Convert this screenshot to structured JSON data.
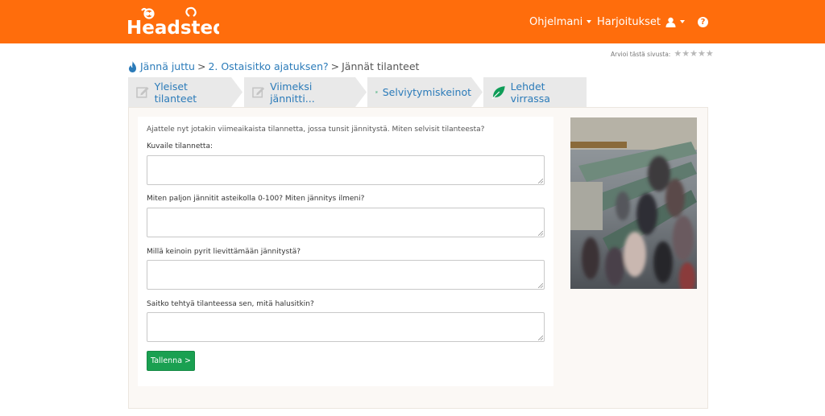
{
  "header": {
    "logo_text": "Headsted",
    "nav": {
      "programs": "Ohjelmani",
      "exercises": "Harjoitukset"
    }
  },
  "rating": {
    "label": "Arvioi tästä sivusta:",
    "stars": 5,
    "filled": 0
  },
  "breadcrumb": {
    "items": [
      "Jännä juttu",
      "2. Ostaisitko ajatuksen?"
    ],
    "current": "Jännät tilanteet",
    "separator": ">"
  },
  "tabs": [
    {
      "label": "Yleiset tilanteet",
      "icon": "edit-icon"
    },
    {
      "label": "Viimeksi jännitti...",
      "icon": "edit-icon"
    },
    {
      "label": "Selviytymiskeinot",
      "icon": "edit-icon"
    },
    {
      "label": "Lehdet virrassa",
      "icon": "leaf-icon"
    }
  ],
  "form": {
    "intro": "Ajattele nyt jotakin viimeaikaista tilannetta, jossa tunsit jännitystä. Miten selvisit tilanteesta?",
    "fields": [
      {
        "label": "Kuvaile tilannetta:",
        "value": ""
      },
      {
        "label": "Miten paljon jännitit asteikolla 0-100? Miten jännitys ilmeni?",
        "value": ""
      },
      {
        "label": "Millä keinoin pyrit lievittämään jännitystä?",
        "value": ""
      },
      {
        "label": "Saitko tehtyä tilanteessa sen, mitä halusitkin?",
        "value": ""
      }
    ],
    "save_label": "Tallenna >"
  },
  "colors": {
    "brand": "#ff6d0c",
    "link": "#2b7bb9",
    "tab_icon": "#0f9d58",
    "button": "#1aa051"
  }
}
